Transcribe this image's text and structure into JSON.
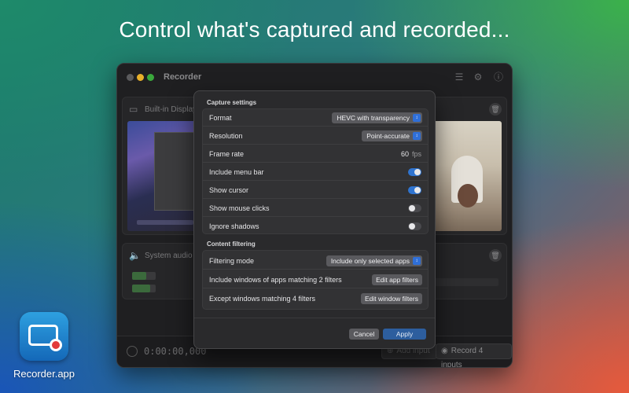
{
  "headline": "Control what's captured and recorded...",
  "app": {
    "icon_name": "recorder-app-icon",
    "label": "Recorder.app"
  },
  "window": {
    "title": "Recorder",
    "toolbar_icons": [
      "list-icon",
      "gear-icon",
      "info-icon"
    ],
    "display_card": {
      "label": "Built-in Display,",
      "icon": "display-icon"
    },
    "audio_card": {
      "label": "System audio",
      "icon": "speaker-icon",
      "meters": [
        0.6,
        0.75
      ]
    },
    "bottom_bar": {
      "timer": "0:00:00,000",
      "add_input": "Add input",
      "record": "Record 4 inputs"
    }
  },
  "sheet": {
    "capture_title": "Capture settings",
    "capture_rows": {
      "format": {
        "label": "Format",
        "value": "HEVC with transparency"
      },
      "resolution": {
        "label": "Resolution",
        "value": "Point-accurate"
      },
      "frame_rate": {
        "label": "Frame rate",
        "value": "60",
        "unit": "fps"
      },
      "menu_bar": {
        "label": "Include menu bar",
        "on": true
      },
      "cursor": {
        "label": "Show cursor",
        "on": true
      },
      "mouse_clicks": {
        "label": "Show mouse clicks",
        "on": false
      },
      "shadows": {
        "label": "Ignore shadows",
        "on": false
      }
    },
    "filter_title": "Content filtering",
    "filter_rows": {
      "mode": {
        "label": "Filtering mode",
        "value": "Include only selected apps"
      },
      "apps": {
        "label": "Include windows of apps matching 2 filters",
        "button": "Edit app filters"
      },
      "windows": {
        "label": "Except windows matching 4 filters",
        "button": "Edit window filters"
      }
    },
    "cancel": "Cancel",
    "apply": "Apply"
  },
  "colors": {
    "accent": "#2f74d0",
    "apply_button": "#2d5e9e",
    "sheet_bg": "#2a2a2c",
    "window_bg": "#1f1f21"
  }
}
